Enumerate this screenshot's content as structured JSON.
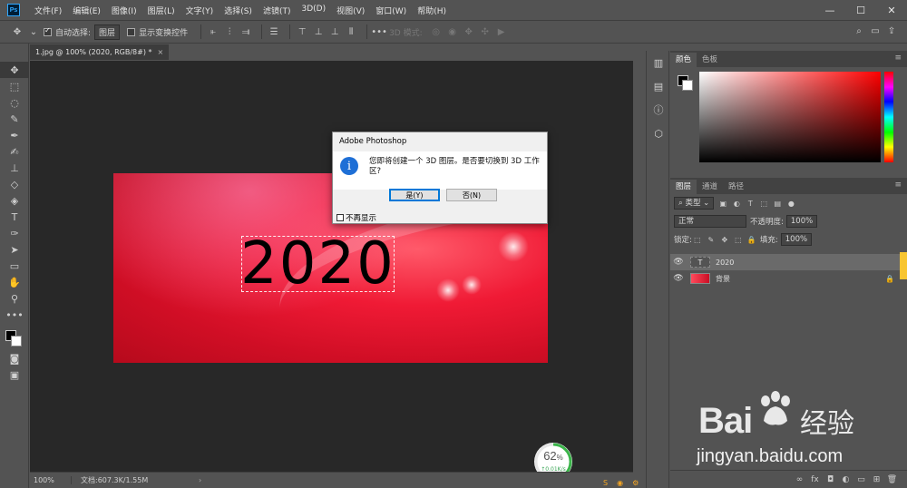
{
  "app": {
    "logo": "Ps",
    "menu": [
      "文件(F)",
      "编辑(E)",
      "图像(I)",
      "图层(L)",
      "文字(Y)",
      "选择(S)",
      "滤镜(T)",
      "3D(D)",
      "视图(V)",
      "窗口(W)",
      "帮助(H)"
    ],
    "window_controls": [
      "—",
      "☐",
      "✕"
    ]
  },
  "options": {
    "auto_select_label": "自动选择:",
    "auto_select_value": "图层",
    "show_transform_label": "显示变换控件",
    "mode_3d_label": "3D 模式:"
  },
  "document": {
    "tab_title": "1.jpg @ 100% (2020, RGB/8#) *",
    "tab_close": "×",
    "image_text": "2020",
    "zoom": "100%",
    "doc_info": "文档:607.3K/1.55M",
    "status_arrow": "›"
  },
  "progress_widget": {
    "percent": "62",
    "percent_sign": "%",
    "speed": "↑0.01K/s",
    "value": 0.62,
    "ring_color": "#3bb54a"
  },
  "color_panel": {
    "tabs": [
      "颜色",
      "色板"
    ],
    "foreground": "#000000",
    "background": "#ffffff"
  },
  "layers_panel": {
    "tabs": [
      "图层",
      "通道",
      "路径"
    ],
    "filter_kind": "类型",
    "blend_mode": "正常",
    "opacity_label": "不透明度:",
    "opacity_value": "100%",
    "lock_label": "锁定:",
    "fill_label": "填充:",
    "fill_value": "100%",
    "layers": [
      {
        "name": "2020",
        "thumb": "T",
        "kind": "text",
        "selected": true
      },
      {
        "name": "背景",
        "kind": "image",
        "selected": false,
        "locked": true
      }
    ],
    "footer_icons": [
      "link-icon",
      "fx-icon",
      "mask-icon",
      "adjustment-icon",
      "group-icon",
      "new-layer-icon",
      "trash-icon"
    ],
    "footer_glyphs": [
      "∞",
      "fx",
      "◘",
      "◐",
      "▭",
      "⊞",
      "🗑"
    ]
  },
  "dialog": {
    "title": "Adobe Photoshop",
    "info_glyph": "i",
    "message": "您即将创建一个 3D 图层。是否要切换到 3D 工作区?",
    "yes_label": "是(Y)",
    "no_label": "否(N)",
    "dont_show_label": "不再显示"
  },
  "watermark": {
    "brand_left": "Bai",
    "brand_right": "经验",
    "url": "jingyan.baidu.com"
  }
}
